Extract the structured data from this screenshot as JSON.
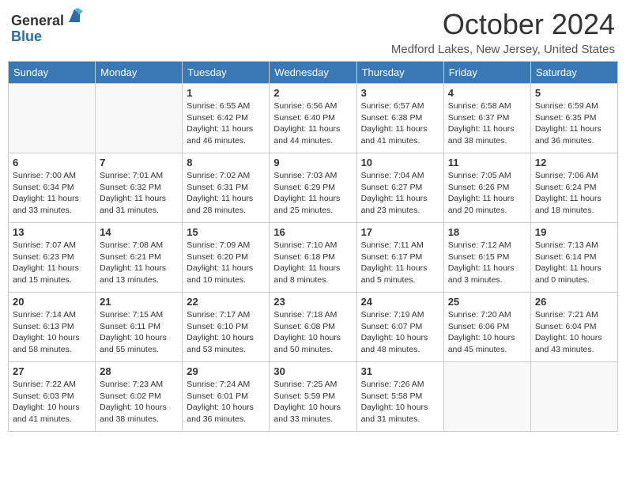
{
  "header": {
    "logo_line1": "General",
    "logo_line2": "Blue",
    "month_title": "October 2024",
    "location": "Medford Lakes, New Jersey, United States"
  },
  "weekdays": [
    "Sunday",
    "Monday",
    "Tuesday",
    "Wednesday",
    "Thursday",
    "Friday",
    "Saturday"
  ],
  "weeks": [
    [
      {
        "day": "",
        "detail": ""
      },
      {
        "day": "",
        "detail": ""
      },
      {
        "day": "1",
        "detail": "Sunrise: 6:55 AM\nSunset: 6:42 PM\nDaylight: 11 hours and 46 minutes."
      },
      {
        "day": "2",
        "detail": "Sunrise: 6:56 AM\nSunset: 6:40 PM\nDaylight: 11 hours and 44 minutes."
      },
      {
        "day": "3",
        "detail": "Sunrise: 6:57 AM\nSunset: 6:38 PM\nDaylight: 11 hours and 41 minutes."
      },
      {
        "day": "4",
        "detail": "Sunrise: 6:58 AM\nSunset: 6:37 PM\nDaylight: 11 hours and 38 minutes."
      },
      {
        "day": "5",
        "detail": "Sunrise: 6:59 AM\nSunset: 6:35 PM\nDaylight: 11 hours and 36 minutes."
      }
    ],
    [
      {
        "day": "6",
        "detail": "Sunrise: 7:00 AM\nSunset: 6:34 PM\nDaylight: 11 hours and 33 minutes."
      },
      {
        "day": "7",
        "detail": "Sunrise: 7:01 AM\nSunset: 6:32 PM\nDaylight: 11 hours and 31 minutes."
      },
      {
        "day": "8",
        "detail": "Sunrise: 7:02 AM\nSunset: 6:31 PM\nDaylight: 11 hours and 28 minutes."
      },
      {
        "day": "9",
        "detail": "Sunrise: 7:03 AM\nSunset: 6:29 PM\nDaylight: 11 hours and 25 minutes."
      },
      {
        "day": "10",
        "detail": "Sunrise: 7:04 AM\nSunset: 6:27 PM\nDaylight: 11 hours and 23 minutes."
      },
      {
        "day": "11",
        "detail": "Sunrise: 7:05 AM\nSunset: 6:26 PM\nDaylight: 11 hours and 20 minutes."
      },
      {
        "day": "12",
        "detail": "Sunrise: 7:06 AM\nSunset: 6:24 PM\nDaylight: 11 hours and 18 minutes."
      }
    ],
    [
      {
        "day": "13",
        "detail": "Sunrise: 7:07 AM\nSunset: 6:23 PM\nDaylight: 11 hours and 15 minutes."
      },
      {
        "day": "14",
        "detail": "Sunrise: 7:08 AM\nSunset: 6:21 PM\nDaylight: 11 hours and 13 minutes."
      },
      {
        "day": "15",
        "detail": "Sunrise: 7:09 AM\nSunset: 6:20 PM\nDaylight: 11 hours and 10 minutes."
      },
      {
        "day": "16",
        "detail": "Sunrise: 7:10 AM\nSunset: 6:18 PM\nDaylight: 11 hours and 8 minutes."
      },
      {
        "day": "17",
        "detail": "Sunrise: 7:11 AM\nSunset: 6:17 PM\nDaylight: 11 hours and 5 minutes."
      },
      {
        "day": "18",
        "detail": "Sunrise: 7:12 AM\nSunset: 6:15 PM\nDaylight: 11 hours and 3 minutes."
      },
      {
        "day": "19",
        "detail": "Sunrise: 7:13 AM\nSunset: 6:14 PM\nDaylight: 11 hours and 0 minutes."
      }
    ],
    [
      {
        "day": "20",
        "detail": "Sunrise: 7:14 AM\nSunset: 6:13 PM\nDaylight: 10 hours and 58 minutes."
      },
      {
        "day": "21",
        "detail": "Sunrise: 7:15 AM\nSunset: 6:11 PM\nDaylight: 10 hours and 55 minutes."
      },
      {
        "day": "22",
        "detail": "Sunrise: 7:17 AM\nSunset: 6:10 PM\nDaylight: 10 hours and 53 minutes."
      },
      {
        "day": "23",
        "detail": "Sunrise: 7:18 AM\nSunset: 6:08 PM\nDaylight: 10 hours and 50 minutes."
      },
      {
        "day": "24",
        "detail": "Sunrise: 7:19 AM\nSunset: 6:07 PM\nDaylight: 10 hours and 48 minutes."
      },
      {
        "day": "25",
        "detail": "Sunrise: 7:20 AM\nSunset: 6:06 PM\nDaylight: 10 hours and 45 minutes."
      },
      {
        "day": "26",
        "detail": "Sunrise: 7:21 AM\nSunset: 6:04 PM\nDaylight: 10 hours and 43 minutes."
      }
    ],
    [
      {
        "day": "27",
        "detail": "Sunrise: 7:22 AM\nSunset: 6:03 PM\nDaylight: 10 hours and 41 minutes."
      },
      {
        "day": "28",
        "detail": "Sunrise: 7:23 AM\nSunset: 6:02 PM\nDaylight: 10 hours and 38 minutes."
      },
      {
        "day": "29",
        "detail": "Sunrise: 7:24 AM\nSunset: 6:01 PM\nDaylight: 10 hours and 36 minutes."
      },
      {
        "day": "30",
        "detail": "Sunrise: 7:25 AM\nSunset: 5:59 PM\nDaylight: 10 hours and 33 minutes."
      },
      {
        "day": "31",
        "detail": "Sunrise: 7:26 AM\nSunset: 5:58 PM\nDaylight: 10 hours and 31 minutes."
      },
      {
        "day": "",
        "detail": ""
      },
      {
        "day": "",
        "detail": ""
      }
    ]
  ]
}
